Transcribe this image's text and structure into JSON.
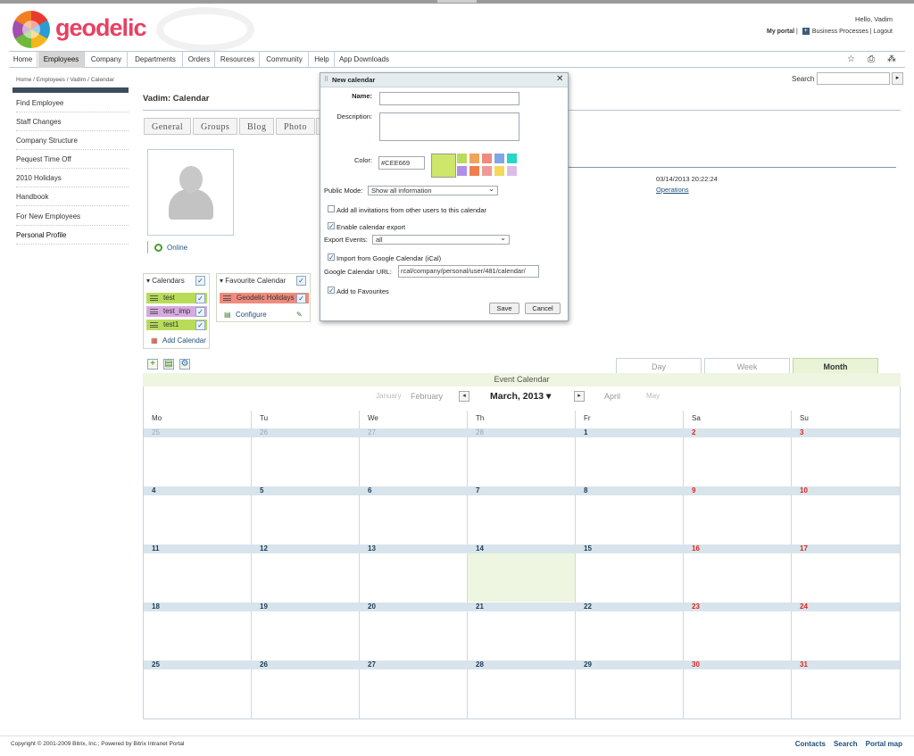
{
  "header": {
    "logo_text": "geodelic",
    "hello": "Hello, Vadim",
    "my_portal": "My portal",
    "business_processes": "Business Processes",
    "logout": "Logout"
  },
  "nav": {
    "items": [
      "Home",
      "Employees",
      "Company",
      "Departments",
      "Orders",
      "Resources",
      "Community",
      "Help",
      "App Downloads"
    ],
    "active": "Employees"
  },
  "breadcrumb": "Home / Employees / Vadim / Calendar",
  "search": {
    "label": "Search",
    "value": ""
  },
  "sidebar": {
    "items": [
      "Find Employee",
      "Staff Changes",
      "Company Structure",
      "Pequest Time Off",
      "2010 Holidays",
      "Handbook",
      "For New Employees",
      "Personal Profile"
    ]
  },
  "page": {
    "title": "Vadim: Calendar",
    "tabs": [
      "General",
      "Groups",
      "Blog",
      "Photo"
    ],
    "online": "Online",
    "datetime": "03/14/2013 20:22:24",
    "operations": "Operations"
  },
  "calendars": {
    "header": "Calendars",
    "items": [
      {
        "name": "test",
        "color": "#b8dc58"
      },
      {
        "name": "test_imp",
        "color": "#d6a9e0"
      },
      {
        "name": "test1",
        "color": "#b8dc58"
      }
    ],
    "add_label": "Add Calendar"
  },
  "favourites": {
    "header": "Favourite Calendar",
    "items": [
      {
        "name": "Geodelic Holidays",
        "color": "#f08a7c"
      }
    ],
    "configure_label": "Configure"
  },
  "views": {
    "tabs": [
      "Day",
      "Week",
      "Month"
    ],
    "active": "Month"
  },
  "event_calendar": {
    "title": "Event Calendar",
    "prev_months": [
      "January",
      "February"
    ],
    "current": "March, 2013",
    "next_months": [
      "April",
      "May"
    ],
    "weekdays": [
      "Mo",
      "Tu",
      "We",
      "Th",
      "Fr",
      "Sa",
      "Su"
    ],
    "weeks": [
      [
        {
          "d": "25",
          "prev": true
        },
        {
          "d": "26",
          "prev": true
        },
        {
          "d": "27",
          "prev": true
        },
        {
          "d": "28",
          "prev": true
        },
        {
          "d": "1"
        },
        {
          "d": "2"
        },
        {
          "d": "3"
        }
      ],
      [
        {
          "d": "4"
        },
        {
          "d": "5"
        },
        {
          "d": "6"
        },
        {
          "d": "7"
        },
        {
          "d": "8"
        },
        {
          "d": "9"
        },
        {
          "d": "10"
        }
      ],
      [
        {
          "d": "11"
        },
        {
          "d": "12"
        },
        {
          "d": "13"
        },
        {
          "d": "14"
        },
        {
          "d": "15"
        },
        {
          "d": "16"
        },
        {
          "d": "17"
        }
      ],
      [
        {
          "d": "18"
        },
        {
          "d": "19"
        },
        {
          "d": "20"
        },
        {
          "d": "21"
        },
        {
          "d": "22"
        },
        {
          "d": "23"
        },
        {
          "d": "24"
        }
      ],
      [
        {
          "d": "25"
        },
        {
          "d": "26"
        },
        {
          "d": "27"
        },
        {
          "d": "28"
        },
        {
          "d": "29"
        },
        {
          "d": "30"
        },
        {
          "d": "31"
        }
      ]
    ],
    "today": "14"
  },
  "modal": {
    "title": "New calendar",
    "name_label": "Name:",
    "name_value": "",
    "description_label": "Description:",
    "description_value": "",
    "color_label": "Color:",
    "color_value": "#CEE669",
    "swatches": [
      "#b8dc58",
      "#f0a35a",
      "#f08a7c",
      "#7fa7e8",
      "#26d7c7",
      "#b18ee8",
      "#f07e4e",
      "#f09a98",
      "#f3d85a",
      "#dcbde8"
    ],
    "public_mode_label": "Public Mode:",
    "public_mode_value": "Show all information",
    "add_invitations_label": "Add all invitations from other users to this calendar",
    "add_invitations_checked": false,
    "enable_export_label": "Enable calendar export",
    "enable_export_checked": true,
    "export_events_label": "Export Events:",
    "export_events_value": "all",
    "import_google_label": "Import from Google Calendar (iCal)",
    "import_google_checked": true,
    "google_url_label": "Google Calendar URL:",
    "google_url_value": "rcal/company/personal/user/481/calendar/",
    "add_fav_label": "Add to Favourites",
    "add_fav_checked": true,
    "save_label": "Save",
    "cancel_label": "Cancel"
  },
  "footer": {
    "copyright": "Copyright © 2001-2009 Bitrix, Inc.; Powered by Bitrix Intranet Portal",
    "links": [
      "Contacts",
      "Search",
      "Portal map"
    ]
  }
}
